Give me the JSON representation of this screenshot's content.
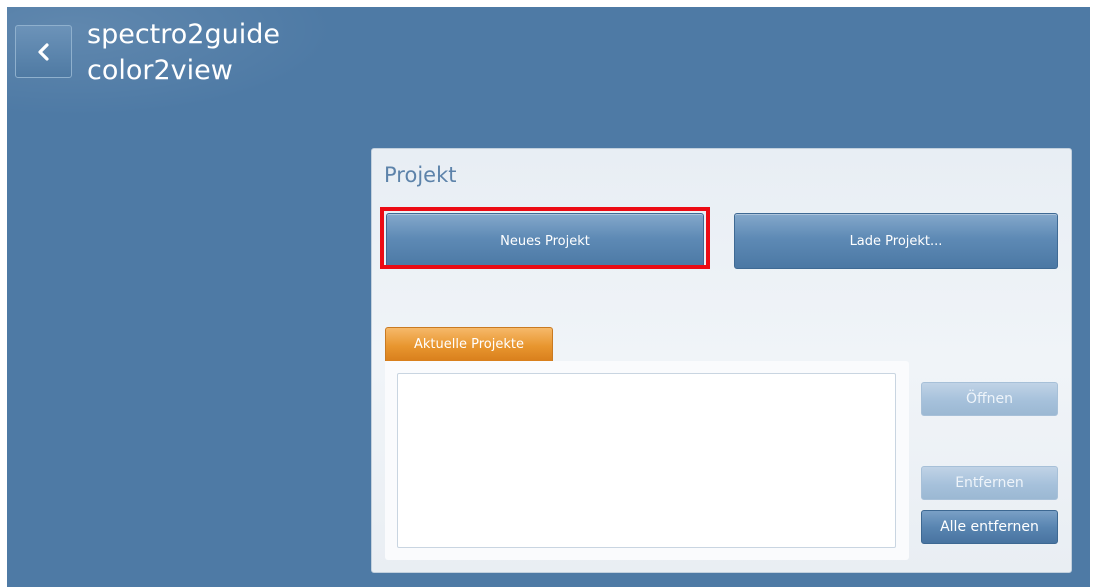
{
  "header": {
    "title_line1": "spectro2guide",
    "title_line2": "color2view",
    "back_icon": "chevron-left-icon"
  },
  "project_panel": {
    "title": "Projekt",
    "new_project_label": "Neues Projekt",
    "load_project_label": "Lade Projekt...",
    "tab_label": "Aktuelle Projekte",
    "recent_projects": [],
    "open_label": "Öffnen",
    "remove_label": "Entfernen",
    "remove_all_label": "Alle entfernen"
  },
  "colors": {
    "background": "#4e7aa5",
    "tab_accent": "#e8962f",
    "highlight": "#ec0b14"
  }
}
